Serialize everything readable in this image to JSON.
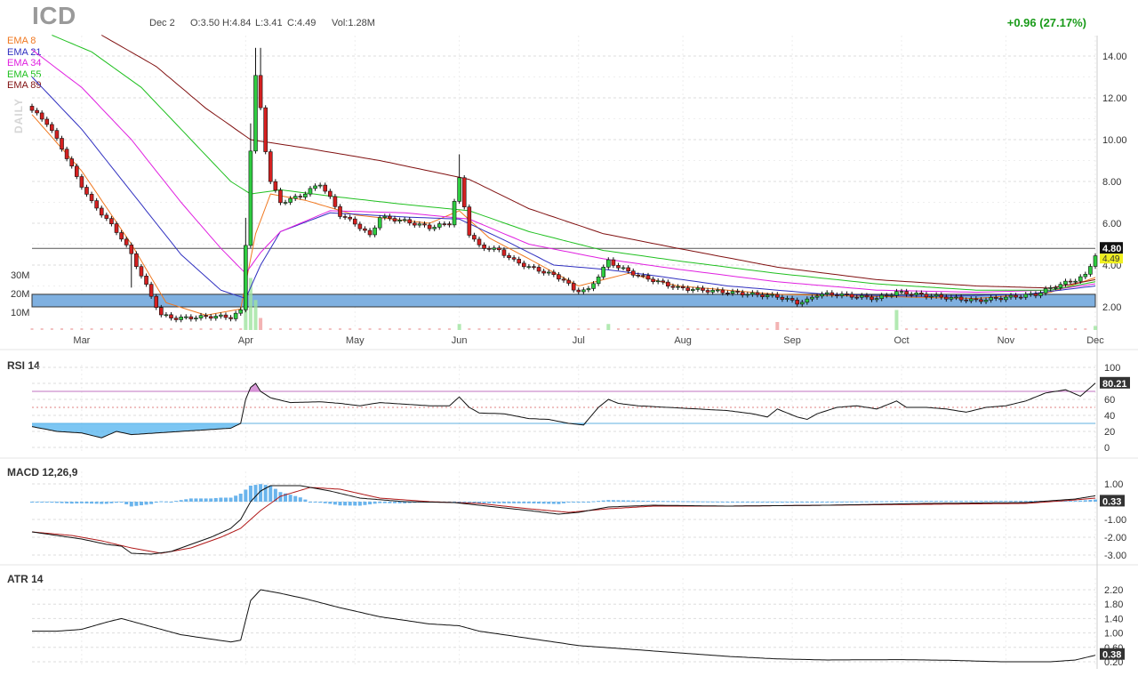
{
  "header": {
    "ticker": "ICD",
    "date": "Dec 2",
    "open": "O:3.50",
    "high": "H:4.84",
    "low": "L:3.41",
    "close": "C:4.49",
    "volume": "Vol:1.28M",
    "change": "+0.96 (27.17%)",
    "period": "DAILY"
  },
  "legend": [
    {
      "label": "EMA 8",
      "color": "#f07820"
    },
    {
      "label": "EMA 21",
      "color": "#3030c0"
    },
    {
      "label": "EMA 34",
      "color": "#e020e0"
    },
    {
      "label": "EMA 55",
      "color": "#20c020"
    },
    {
      "label": "EMA 89",
      "color": "#801010"
    }
  ],
  "price_panel": {
    "y_ticks": [
      "14.00",
      "12.00",
      "10.00",
      "8.00",
      "6.00",
      "4.00",
      "2.00"
    ],
    "volume_ticks": [
      "30M",
      "20M",
      "10M"
    ],
    "x_months": [
      "Mar",
      "Apr",
      "May",
      "Jun",
      "Jul",
      "Aug",
      "Sep",
      "Oct",
      "Nov",
      "Dec"
    ],
    "last_price_label": "4.80",
    "last_close_label": "4.49",
    "hline_price": 4.8,
    "zone": [
      2.0,
      2.6
    ]
  },
  "rsi_panel": {
    "title": "RSI 14",
    "y_ticks": [
      "100",
      "80",
      "60",
      "40",
      "20",
      "0"
    ],
    "last_label": "80.21",
    "upper": 70,
    "mid": 50,
    "lower": 30
  },
  "macd_panel": {
    "title": "MACD 12,26,9",
    "y_ticks": [
      "1.00",
      "0.00",
      "-1.00",
      "-2.00",
      "-3.00"
    ],
    "last_label": "0.33"
  },
  "atr_panel": {
    "title": "ATR 14",
    "y_ticks": [
      "2.20",
      "1.80",
      "1.40",
      "1.00",
      "0.60",
      "0.20"
    ],
    "last_label": "0.38"
  },
  "colors": {
    "up": "#2ecc40",
    "down": "#d42020",
    "zone": "#7fb0e0",
    "rsi_fill": "#5bb8f0",
    "macd_hist": "#6ab4ec",
    "grid": "#dddddd"
  },
  "chart_data": {
    "type": "candlestick",
    "x_range": [
      "Feb",
      "Dec 2"
    ],
    "close_path": [
      [
        0,
        11.4
      ],
      [
        3,
        10.8
      ],
      [
        6,
        9.6
      ],
      [
        9,
        8.2
      ],
      [
        12,
        7.0
      ],
      [
        15,
        6.2
      ],
      [
        18,
        5.3
      ],
      [
        20,
        4.5
      ],
      [
        22,
        3.5
      ],
      [
        24,
        2.5
      ],
      [
        26,
        1.6
      ],
      [
        29,
        1.45
      ],
      [
        33,
        1.5
      ],
      [
        37,
        1.55
      ],
      [
        40,
        1.5
      ],
      [
        42,
        1.8
      ],
      [
        43,
        5.0
      ],
      [
        44,
        9.5
      ],
      [
        45,
        13.0
      ],
      [
        46,
        11.5
      ],
      [
        47,
        9.5
      ],
      [
        48,
        8.0
      ],
      [
        50,
        7.0
      ],
      [
        54,
        7.3
      ],
      [
        58,
        7.9
      ],
      [
        60,
        7.2
      ],
      [
        62,
        6.4
      ],
      [
        65,
        6.0
      ],
      [
        68,
        5.4
      ],
      [
        70,
        6.3
      ],
      [
        75,
        6.1
      ],
      [
        80,
        5.8
      ],
      [
        84,
        6.0
      ],
      [
        86,
        8.1
      ],
      [
        87,
        6.8
      ],
      [
        88,
        5.5
      ],
      [
        90,
        4.9
      ],
      [
        94,
        4.7
      ],
      [
        97,
        4.2
      ],
      [
        100,
        3.9
      ],
      [
        104,
        3.6
      ],
      [
        107,
        3.3
      ],
      [
        109,
        2.8
      ],
      [
        112,
        2.8
      ],
      [
        114,
        3.5
      ],
      [
        116,
        4.2
      ],
      [
        118,
        3.9
      ],
      [
        122,
        3.5
      ],
      [
        126,
        3.2
      ],
      [
        130,
        2.9
      ],
      [
        135,
        2.8
      ],
      [
        140,
        2.7
      ],
      [
        145,
        2.6
      ],
      [
        150,
        2.5
      ],
      [
        154,
        2.2
      ],
      [
        156,
        2.3
      ],
      [
        158,
        2.6
      ],
      [
        162,
        2.6
      ],
      [
        166,
        2.5
      ],
      [
        170,
        2.4
      ],
      [
        174,
        2.7
      ],
      [
        178,
        2.6
      ],
      [
        182,
        2.5
      ],
      [
        186,
        2.4
      ],
      [
        190,
        2.3
      ],
      [
        194,
        2.4
      ],
      [
        198,
        2.5
      ],
      [
        202,
        2.6
      ],
      [
        206,
        3.0
      ],
      [
        210,
        3.3
      ],
      [
        212,
        3.5
      ],
      [
        214,
        4.49
      ]
    ],
    "ema": [
      {
        "name": "EMA 8",
        "points": [
          [
            0,
            11.2
          ],
          [
            10,
            8.5
          ],
          [
            20,
            5.0
          ],
          [
            27,
            2.2
          ],
          [
            35,
            1.6
          ],
          [
            42,
            1.9
          ],
          [
            45,
            5.5
          ],
          [
            48,
            7.4
          ],
          [
            55,
            7.1
          ],
          [
            65,
            6.4
          ],
          [
            80,
            6.0
          ],
          [
            86,
            6.6
          ],
          [
            92,
            5.3
          ],
          [
            100,
            4.3
          ],
          [
            110,
            3.0
          ],
          [
            120,
            3.6
          ],
          [
            130,
            3.0
          ],
          [
            150,
            2.6
          ],
          [
            170,
            2.5
          ],
          [
            190,
            2.4
          ],
          [
            205,
            2.7
          ],
          [
            214,
            3.4
          ]
        ]
      },
      {
        "name": "EMA 21",
        "points": [
          [
            0,
            13.0
          ],
          [
            10,
            10.5
          ],
          [
            20,
            7.5
          ],
          [
            30,
            4.5
          ],
          [
            38,
            2.8
          ],
          [
            43,
            2.4
          ],
          [
            46,
            4.0
          ],
          [
            50,
            5.6
          ],
          [
            60,
            6.5
          ],
          [
            75,
            6.3
          ],
          [
            86,
            6.2
          ],
          [
            95,
            5.2
          ],
          [
            105,
            4.0
          ],
          [
            115,
            3.8
          ],
          [
            125,
            3.5
          ],
          [
            140,
            3.0
          ],
          [
            160,
            2.6
          ],
          [
            180,
            2.5
          ],
          [
            200,
            2.6
          ],
          [
            214,
            3.0
          ]
        ]
      },
      {
        "name": "EMA 34",
        "points": [
          [
            0,
            14.3
          ],
          [
            10,
            12.5
          ],
          [
            20,
            10.0
          ],
          [
            30,
            7.0
          ],
          [
            38,
            4.8
          ],
          [
            43,
            3.6
          ],
          [
            46,
            4.6
          ],
          [
            50,
            5.6
          ],
          [
            60,
            6.6
          ],
          [
            75,
            6.5
          ],
          [
            88,
            6.2
          ],
          [
            100,
            5.0
          ],
          [
            115,
            4.3
          ],
          [
            130,
            3.8
          ],
          [
            150,
            3.2
          ],
          [
            170,
            2.8
          ],
          [
            190,
            2.7
          ],
          [
            205,
            2.8
          ],
          [
            214,
            3.1
          ]
        ]
      },
      {
        "name": "EMA 55",
        "points": [
          [
            4,
            15.0
          ],
          [
            12,
            14.2
          ],
          [
            22,
            12.5
          ],
          [
            32,
            10.0
          ],
          [
            40,
            8.0
          ],
          [
            44,
            7.4
          ],
          [
            50,
            7.6
          ],
          [
            60,
            7.3
          ],
          [
            75,
            6.9
          ],
          [
            88,
            6.6
          ],
          [
            100,
            5.6
          ],
          [
            115,
            4.7
          ],
          [
            130,
            4.2
          ],
          [
            150,
            3.6
          ],
          [
            170,
            3.1
          ],
          [
            190,
            2.8
          ],
          [
            205,
            2.8
          ],
          [
            214,
            3.2
          ]
        ]
      },
      {
        "name": "EMA 89",
        "points": [
          [
            14,
            15.0
          ],
          [
            25,
            13.5
          ],
          [
            35,
            11.5
          ],
          [
            44,
            10.0
          ],
          [
            55,
            9.6
          ],
          [
            70,
            9.0
          ],
          [
            88,
            8.1
          ],
          [
            100,
            6.7
          ],
          [
            115,
            5.5
          ],
          [
            130,
            4.8
          ],
          [
            150,
            3.9
          ],
          [
            170,
            3.3
          ],
          [
            190,
            3.0
          ],
          [
            205,
            2.9
          ],
          [
            214,
            3.3
          ]
        ]
      }
    ],
    "volume_spikes": [
      [
        43,
        12
      ],
      [
        44,
        26
      ],
      [
        45,
        15
      ],
      [
        46,
        6
      ],
      [
        86,
        3
      ],
      [
        116,
        3
      ],
      [
        150,
        4
      ],
      [
        174,
        10
      ],
      [
        214,
        2
      ]
    ],
    "rsi": [
      [
        0,
        26
      ],
      [
        5,
        20
      ],
      [
        10,
        18
      ],
      [
        14,
        12
      ],
      [
        17,
        20
      ],
      [
        20,
        16
      ],
      [
        25,
        18
      ],
      [
        30,
        20
      ],
      [
        35,
        22
      ],
      [
        40,
        24
      ],
      [
        42,
        30
      ],
      [
        43,
        60
      ],
      [
        44,
        75
      ],
      [
        45,
        80
      ],
      [
        46,
        70
      ],
      [
        48,
        62
      ],
      [
        52,
        56
      ],
      [
        58,
        57
      ],
      [
        62,
        55
      ],
      [
        66,
        52
      ],
      [
        70,
        56
      ],
      [
        75,
        54
      ],
      [
        80,
        52
      ],
      [
        84,
        52
      ],
      [
        86,
        63
      ],
      [
        88,
        50
      ],
      [
        90,
        43
      ],
      [
        95,
        42
      ],
      [
        100,
        36
      ],
      [
        104,
        35
      ],
      [
        108,
        30
      ],
      [
        111,
        28
      ],
      [
        114,
        50
      ],
      [
        116,
        60
      ],
      [
        118,
        55
      ],
      [
        122,
        52
      ],
      [
        128,
        50
      ],
      [
        134,
        48
      ],
      [
        140,
        46
      ],
      [
        145,
        42
      ],
      [
        148,
        38
      ],
      [
        150,
        48
      ],
      [
        154,
        38
      ],
      [
        156,
        35
      ],
      [
        158,
        42
      ],
      [
        162,
        50
      ],
      [
        166,
        52
      ],
      [
        170,
        48
      ],
      [
        174,
        58
      ],
      [
        176,
        50
      ],
      [
        180,
        50
      ],
      [
        184,
        48
      ],
      [
        188,
        44
      ],
      [
        192,
        50
      ],
      [
        196,
        52
      ],
      [
        200,
        58
      ],
      [
        204,
        68
      ],
      [
        208,
        72
      ],
      [
        211,
        64
      ],
      [
        214,
        80.21
      ]
    ],
    "macd": [
      [
        0,
        -1.7
      ],
      [
        5,
        -1.9
      ],
      [
        10,
        -2.1
      ],
      [
        15,
        -2.4
      ],
      [
        18,
        -2.5
      ],
      [
        20,
        -2.9
      ],
      [
        24,
        -2.95
      ],
      [
        28,
        -2.8
      ],
      [
        32,
        -2.4
      ],
      [
        36,
        -2.0
      ],
      [
        40,
        -1.5
      ],
      [
        42,
        -1.0
      ],
      [
        44,
        0.0
      ],
      [
        46,
        0.6
      ],
      [
        48,
        0.9
      ],
      [
        54,
        0.9
      ],
      [
        60,
        0.6
      ],
      [
        66,
        0.2
      ],
      [
        75,
        0.0
      ],
      [
        85,
        -0.05
      ],
      [
        90,
        -0.2
      ],
      [
        100,
        -0.5
      ],
      [
        106,
        -0.7
      ],
      [
        110,
        -0.6
      ],
      [
        116,
        -0.3
      ],
      [
        125,
        -0.2
      ],
      [
        140,
        -0.25
      ],
      [
        160,
        -0.2
      ],
      [
        180,
        -0.1
      ],
      [
        200,
        -0.05
      ],
      [
        210,
        0.15
      ],
      [
        214,
        0.33
      ]
    ],
    "macd_signal": [
      [
        0,
        -1.7
      ],
      [
        8,
        -1.9
      ],
      [
        14,
        -2.2
      ],
      [
        20,
        -2.6
      ],
      [
        26,
        -2.9
      ],
      [
        32,
        -2.6
      ],
      [
        38,
        -2.0
      ],
      [
        42,
        -1.5
      ],
      [
        46,
        -0.5
      ],
      [
        50,
        0.3
      ],
      [
        56,
        0.8
      ],
      [
        62,
        0.7
      ],
      [
        70,
        0.2
      ],
      [
        80,
        0.0
      ],
      [
        90,
        -0.1
      ],
      [
        100,
        -0.4
      ],
      [
        108,
        -0.6
      ],
      [
        116,
        -0.4
      ],
      [
        125,
        -0.25
      ],
      [
        140,
        -0.25
      ],
      [
        160,
        -0.2
      ],
      [
        180,
        -0.15
      ],
      [
        200,
        -0.1
      ],
      [
        210,
        0.1
      ],
      [
        214,
        0.2
      ]
    ],
    "atr": [
      [
        0,
        1.05
      ],
      [
        5,
        1.05
      ],
      [
        10,
        1.1
      ],
      [
        15,
        1.3
      ],
      [
        18,
        1.4
      ],
      [
        22,
        1.25
      ],
      [
        26,
        1.1
      ],
      [
        30,
        0.95
      ],
      [
        35,
        0.85
      ],
      [
        40,
        0.75
      ],
      [
        42,
        0.8
      ],
      [
        44,
        1.9
      ],
      [
        46,
        2.2
      ],
      [
        50,
        2.1
      ],
      [
        55,
        1.95
      ],
      [
        62,
        1.7
      ],
      [
        70,
        1.45
      ],
      [
        80,
        1.25
      ],
      [
        86,
        1.2
      ],
      [
        90,
        1.05
      ],
      [
        100,
        0.85
      ],
      [
        110,
        0.65
      ],
      [
        120,
        0.55
      ],
      [
        130,
        0.45
      ],
      [
        140,
        0.35
      ],
      [
        150,
        0.28
      ],
      [
        160,
        0.25
      ],
      [
        175,
        0.26
      ],
      [
        185,
        0.24
      ],
      [
        195,
        0.2
      ],
      [
        205,
        0.2
      ],
      [
        210,
        0.25
      ],
      [
        214,
        0.38
      ]
    ],
    "ylim_price": [
      1.0,
      15.0
    ],
    "ylim_rsi": [
      0,
      100
    ],
    "ylim_macd": [
      -3.0,
      1.0
    ],
    "ylim_atr": [
      0.2,
      2.2
    ]
  }
}
